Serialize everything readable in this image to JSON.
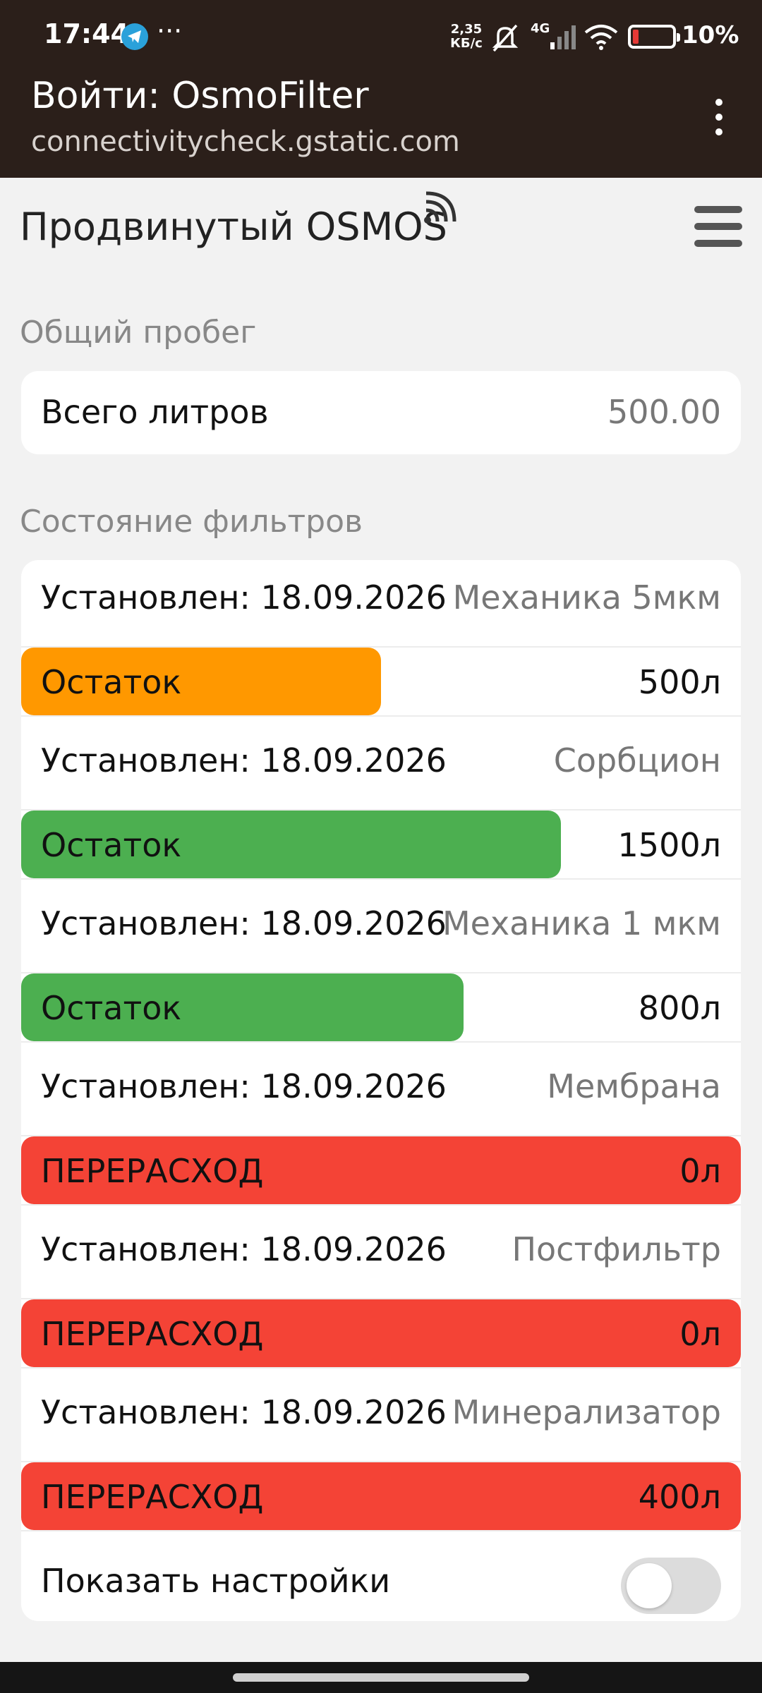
{
  "status_bar": {
    "time": "17:44",
    "more": "···",
    "speed_value": "2,35",
    "speed_unit": "КБ/с",
    "network": "4G",
    "battery_percent": "10%",
    "battery_level": 0.1,
    "icons": [
      "telegram-icon",
      "mute-icon",
      "signal-icon",
      "wifi-icon",
      "battery-icon"
    ]
  },
  "browser": {
    "title": "Войти: OsmoFilter",
    "url": "connectivitycheck.gstatic.com"
  },
  "app": {
    "title": "Продвинутый OSMOS",
    "connection_icon": "wifi-signal-icon"
  },
  "mileage": {
    "section_label": "Общий пробег",
    "label": "Всего литров",
    "value": "500.00"
  },
  "filters": {
    "section_label": "Состояние фильтров",
    "items": [
      {
        "installed": "Установлен: 18.09.2026",
        "name": "Механика 5мкм",
        "status": "Остаток",
        "remaining": "500л",
        "fill": 0.5,
        "color": "#ff9800"
      },
      {
        "installed": "Установлен: 18.09.2026",
        "name": "Сорбцион",
        "status": "Остаток",
        "remaining": "1500л",
        "fill": 0.75,
        "color": "#4caf50"
      },
      {
        "installed": "Установлен: 18.09.2026",
        "name": "Механика 1 мкм",
        "status": "Остаток",
        "remaining": "800л",
        "fill": 0.615,
        "color": "#4caf50"
      },
      {
        "installed": "Установлен: 18.09.2026",
        "name": "Мембрана",
        "status": "ПЕРЕРАСХОД",
        "remaining": "0л",
        "fill": 1.0,
        "color": "#f44336"
      },
      {
        "installed": "Установлен: 18.09.2026",
        "name": "Постфильтр",
        "status": "ПЕРЕРАСХОД",
        "remaining": "0л",
        "fill": 1.0,
        "color": "#f44336"
      },
      {
        "installed": "Установлен: 18.09.2026",
        "name": "Минерализатор",
        "status": "ПЕРЕРАСХОД",
        "remaining": "400л",
        "fill": 1.0,
        "color": "#f44336"
      }
    ],
    "settings_label": "Показать настройки",
    "settings_on": false
  }
}
